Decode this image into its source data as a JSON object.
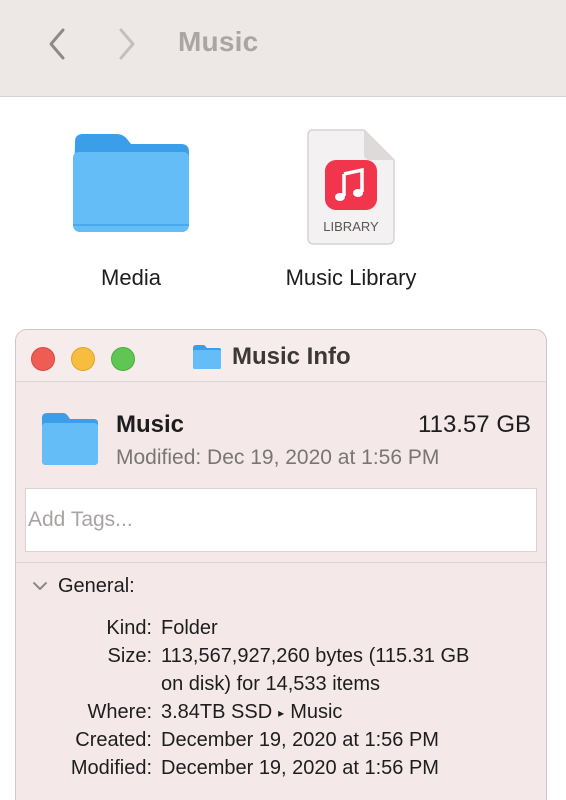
{
  "finder": {
    "title": "Music",
    "nav": {
      "back_icon": "chevron-left-icon",
      "forward_icon": "chevron-right-icon"
    },
    "items": [
      {
        "name": "Media",
        "icon": "folder-icon"
      },
      {
        "name": "Music Library",
        "icon": "music-library-file-icon",
        "badge": "LIBRARY"
      }
    ]
  },
  "info_window": {
    "title": "Music Info",
    "title_icon": "folder-icon",
    "name": "Music",
    "size_summary": "113.57 GB",
    "modified_summary": "Modified: Dec 19, 2020 at 1:56 PM",
    "tags_placeholder": "Add Tags...",
    "general": {
      "label": "General:",
      "rows": [
        {
          "key": "Kind:",
          "value": "Folder"
        },
        {
          "key": "Size:",
          "value_line1": "113,567,927,260 bytes (115.31 GB",
          "value_line2": "on disk) for 14,533 items"
        },
        {
          "key": "Where:",
          "value_part1": "3.84TB SSD",
          "value_part2": "Music"
        },
        {
          "key": "Created:",
          "value": "December 19, 2020 at 1:56 PM"
        },
        {
          "key": "Modified:",
          "value": "December 19, 2020 at 1:56 PM"
        }
      ]
    }
  },
  "colors": {
    "folder": "#5ab6f3",
    "traffic_close": "#ee5c54",
    "traffic_minimize": "#f7bd3e",
    "traffic_zoom": "#5fc653",
    "music_app": "#f0354d"
  }
}
